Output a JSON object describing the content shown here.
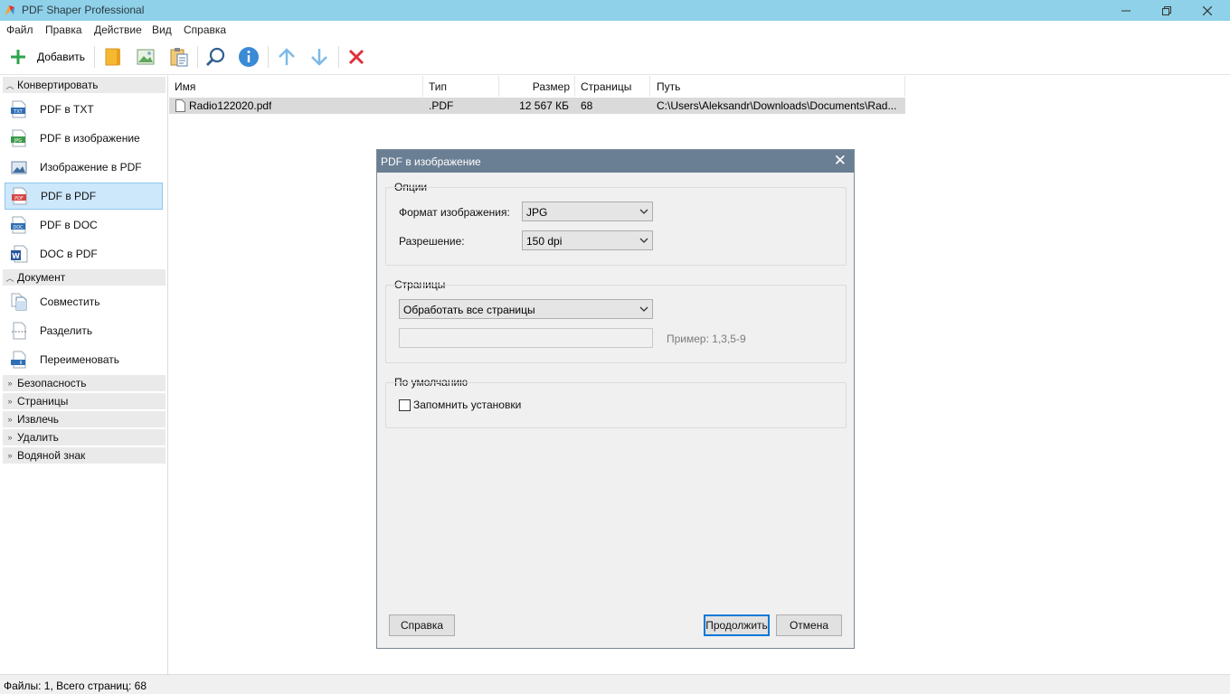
{
  "window": {
    "title": "PDF Shaper Professional"
  },
  "menu": [
    "Файл",
    "Правка",
    "Действие",
    "Вид",
    "Справка"
  ],
  "toolbar": {
    "add_label": "Добавить",
    "icons": [
      "add-icon",
      "open-folder-icon",
      "image-icon",
      "paste-icon",
      "search-icon",
      "info-icon",
      "move-up-icon",
      "move-down-icon",
      "remove-icon"
    ]
  },
  "sidebar": {
    "groups": [
      {
        "label": "Конвертировать",
        "expanded": true,
        "items": [
          {
            "label": "PDF в TXT",
            "icon": "txt-icon"
          },
          {
            "label": "PDF в изображение",
            "icon": "jpg-icon"
          },
          {
            "label": "Изображение в PDF",
            "icon": "picture-icon"
          },
          {
            "label": "PDF в PDF",
            "icon": "pdf-icon",
            "selected": true
          },
          {
            "label": "PDF в DOC",
            "icon": "doc-icon"
          },
          {
            "label": "DOC в PDF",
            "icon": "word-icon"
          }
        ]
      },
      {
        "label": "Документ",
        "expanded": true,
        "items": [
          {
            "label": "Совместить",
            "icon": "merge-icon"
          },
          {
            "label": "Разделить",
            "icon": "split-icon"
          },
          {
            "label": "Переименовать",
            "icon": "rename-icon"
          }
        ]
      },
      {
        "label": "Безопасность",
        "expanded": false
      },
      {
        "label": "Страницы",
        "expanded": false
      },
      {
        "label": "Извлечь",
        "expanded": false
      },
      {
        "label": "Удалить",
        "expanded": false
      },
      {
        "label": "Водяной знак",
        "expanded": false
      }
    ]
  },
  "file_table": {
    "columns": [
      "Имя",
      "Тип",
      "Размер",
      "Страницы",
      "Путь"
    ],
    "rows": [
      {
        "name": "Radio122020.pdf",
        "type": ".PDF",
        "size": "12 567 КБ",
        "pages": "68",
        "path": "C:\\Users\\Aleksandr\\Downloads\\Documents\\Rad..."
      }
    ]
  },
  "status": "Файлы: 1, Всего страниц: 68",
  "dialog": {
    "title": "PDF в изображение",
    "options": {
      "legend": "Опции",
      "format_label": "Формат изображения:",
      "format_value": "JPG",
      "resolution_label": "Разрешение:",
      "resolution_value": "150 dpi"
    },
    "pages": {
      "legend": "Страницы",
      "mode_value": "Обработать все страницы",
      "range_value": "",
      "hint": "Пример: 1,3,5-9"
    },
    "defaults": {
      "legend": "По умолчанию",
      "remember_label": "Запомнить установки",
      "remember_checked": false
    },
    "buttons": {
      "help": "Справка",
      "continue": "Продолжить",
      "cancel": "Отмена"
    }
  },
  "colors": {
    "titlebar": "#8fd1e8",
    "dialog_title": "#6b7f94",
    "selection": "#cde8fb",
    "remove_red": "#e0303a",
    "add_green": "#2da44e",
    "arrow_blue": "#7db9e8"
  }
}
